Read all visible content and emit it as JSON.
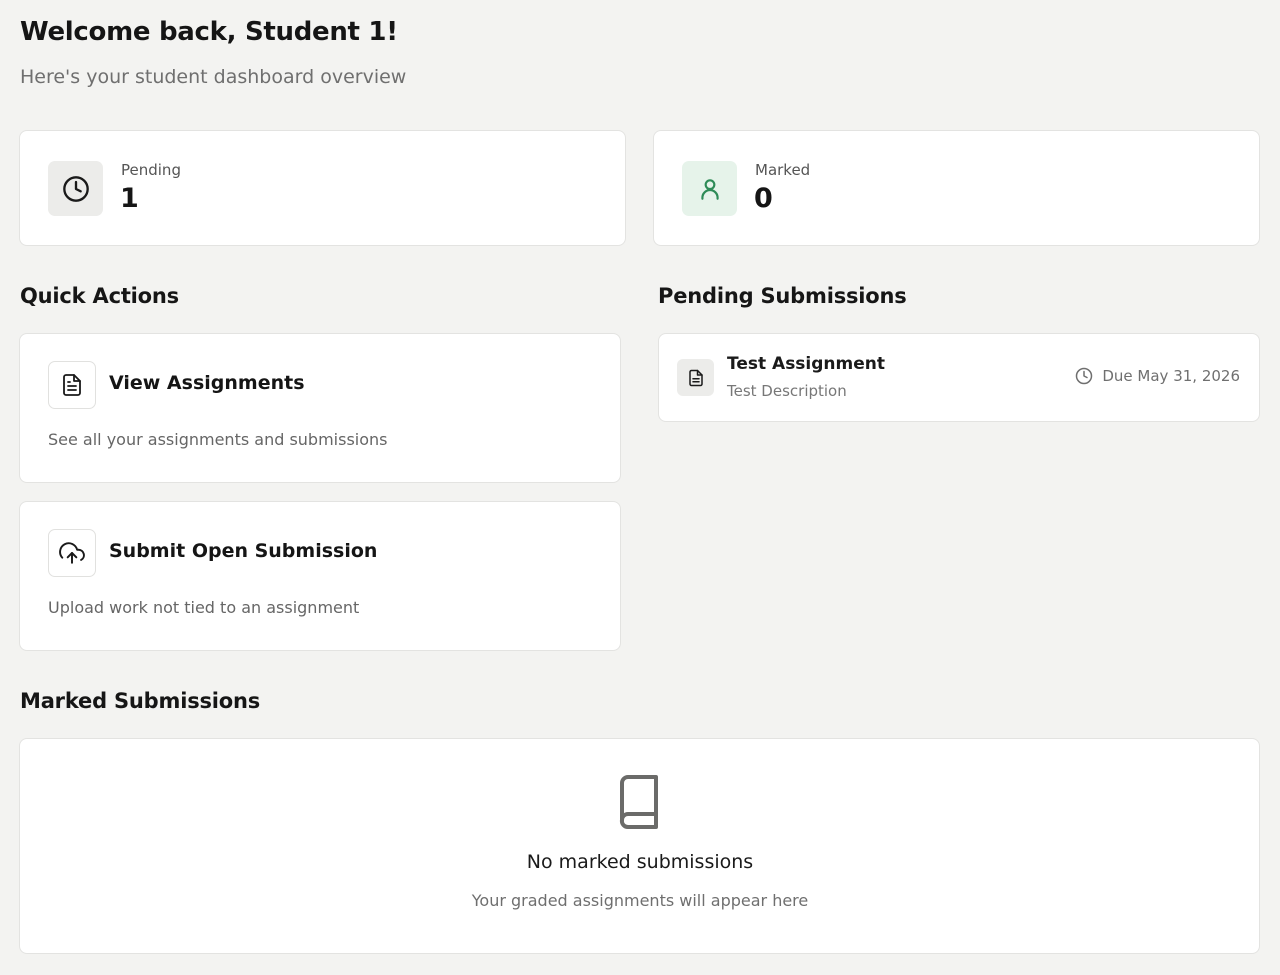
{
  "header": {
    "title": "Welcome back, Student 1!",
    "subtitle": "Here's your student dashboard overview"
  },
  "stats": [
    {
      "label": "Pending",
      "value": "1",
      "icon": "clock-icon",
      "color": "#161616"
    },
    {
      "label": "Marked",
      "value": "0",
      "icon": "user-icon",
      "color": "#2e8b57"
    }
  ],
  "quick_actions": {
    "title": "Quick Actions",
    "items": [
      {
        "title": "View Assignments",
        "description": "See all your assignments and submissions",
        "icon": "document-icon"
      },
      {
        "title": "Submit Open Submission",
        "description": "Upload work not tied to an assignment",
        "icon": "upload-cloud-icon"
      }
    ]
  },
  "pending_submissions": {
    "title": "Pending Submissions",
    "items": [
      {
        "title": "Test Assignment",
        "description": "Test Description",
        "due": "Due May 31, 2026",
        "icon": "document-icon"
      }
    ]
  },
  "marked_submissions": {
    "title": "Marked Submissions",
    "empty_title": "No marked submissions",
    "empty_description": "Your graded assignments will appear here",
    "icon": "book-icon"
  }
}
